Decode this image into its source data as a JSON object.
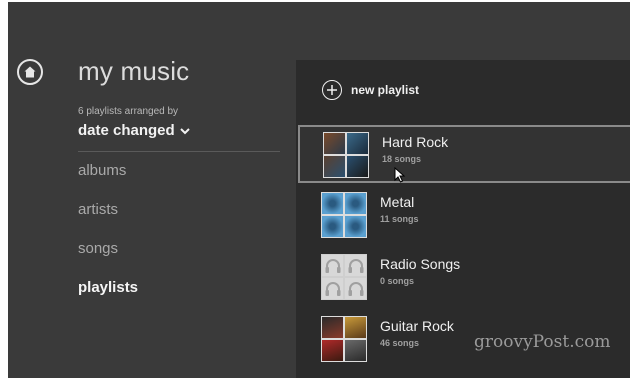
{
  "app": {
    "title": "my music",
    "subtitle": "6 playlists arranged by",
    "sort_value": "date changed"
  },
  "nav": {
    "items": [
      {
        "label": "albums",
        "active": false
      },
      {
        "label": "artists",
        "active": false
      },
      {
        "label": "songs",
        "active": false
      },
      {
        "label": "playlists",
        "active": true
      }
    ]
  },
  "panel": {
    "new_playlist_label": "new playlist",
    "playlists": [
      {
        "name": "Hard Rock",
        "count": "18 songs",
        "selected": true,
        "thumb_colors": [
          "#7a4a2a",
          "#3b6a8a",
          "#5a4030",
          "#2a5070"
        ]
      },
      {
        "name": "Metal",
        "count": "11 songs",
        "selected": false,
        "thumb_colors": [
          "#4a8ab8",
          "#3a7aa8",
          "#5096c2",
          "#3a7aa8"
        ]
      },
      {
        "name": "Radio Songs",
        "count": "0 songs",
        "selected": false,
        "thumb_colors": [
          "#d8d8d8",
          "#d8d8d8",
          "#d8d8d8",
          "#d8d8d8"
        ]
      },
      {
        "name": "Guitar Rock",
        "count": "46 songs",
        "selected": false,
        "thumb_colors": [
          "#8a3a2a",
          "#c89a3a",
          "#b02a2a",
          "#4a4a4a"
        ]
      }
    ]
  },
  "watermark": "groovyPost.com",
  "colors": {
    "background": "#3a3a3a",
    "panel": "#2b2b2b",
    "accent_text": "#f0f0f0"
  }
}
